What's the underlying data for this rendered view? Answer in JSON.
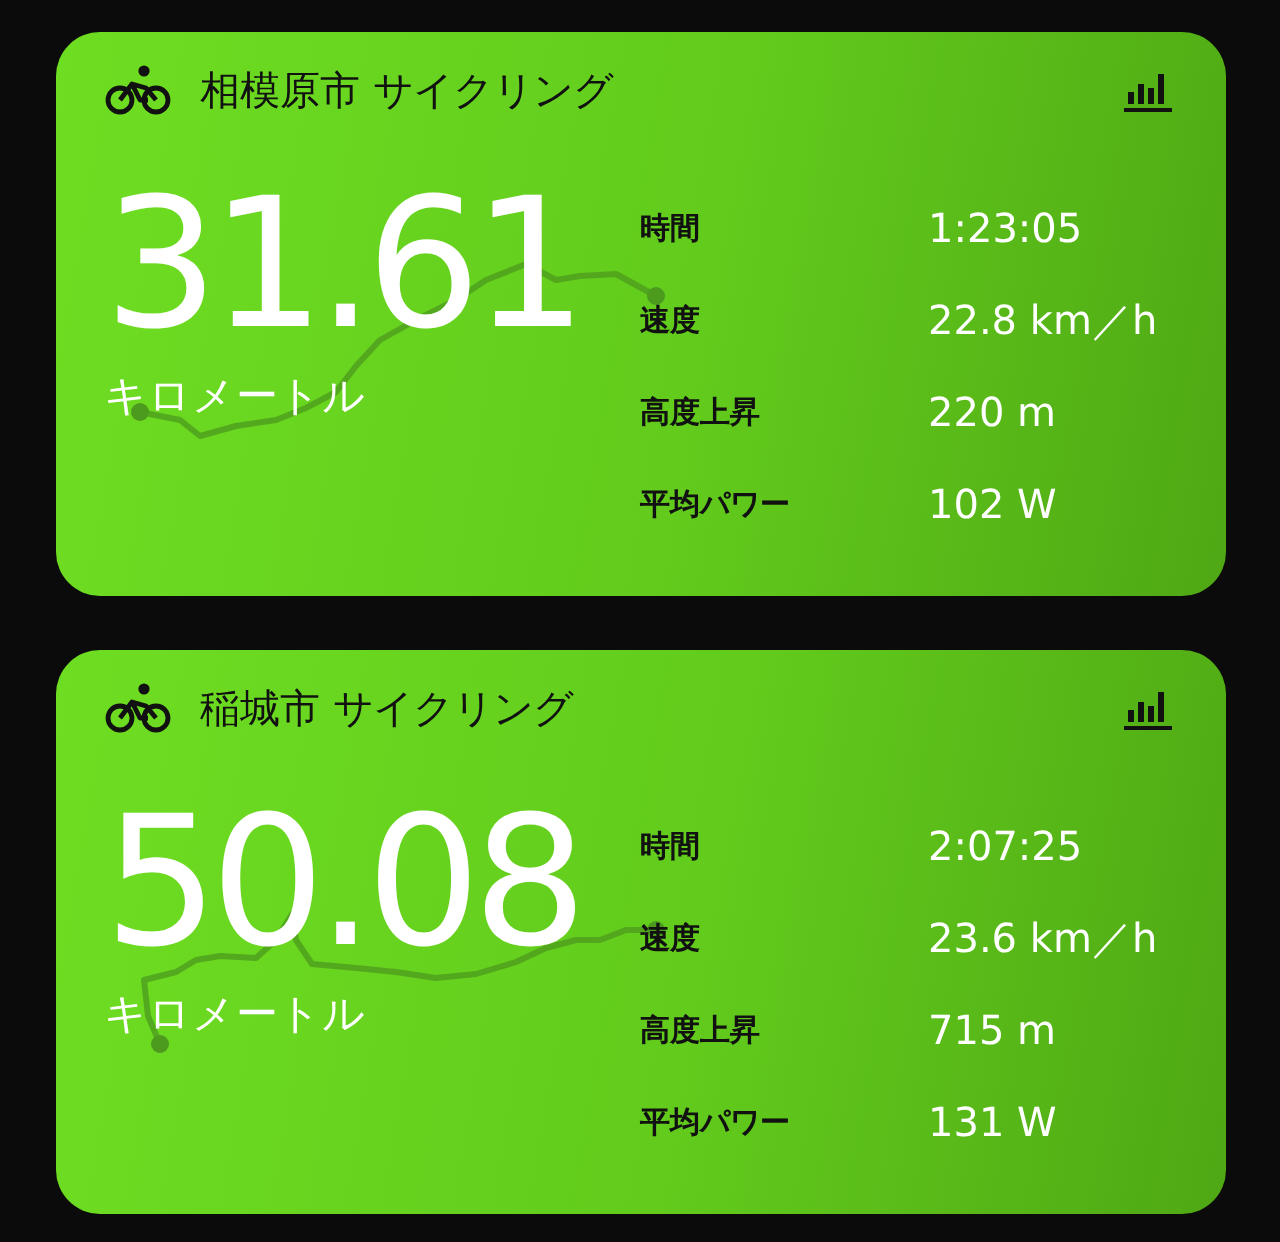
{
  "activities": [
    {
      "title": "相模原市 サイクリング",
      "distance": "31.61",
      "unit": "キロメートル",
      "stats": [
        {
          "label": "時間",
          "value": "1:23:05"
        },
        {
          "label": "速度",
          "value": "22.8 km／h"
        },
        {
          "label": "高度上昇",
          "value": "220 m"
        },
        {
          "label": "平均パワー",
          "value": "102 W"
        }
      ]
    },
    {
      "title": "稲城市 サイクリング",
      "distance": "50.08",
      "unit": "キロメートル",
      "stats": [
        {
          "label": "時間",
          "value": "2:07:25"
        },
        {
          "label": "速度",
          "value": "23.6 km／h"
        },
        {
          "label": "高度上昇",
          "value": "715 m"
        },
        {
          "label": "平均パワー",
          "value": "131 W"
        }
      ]
    }
  ]
}
